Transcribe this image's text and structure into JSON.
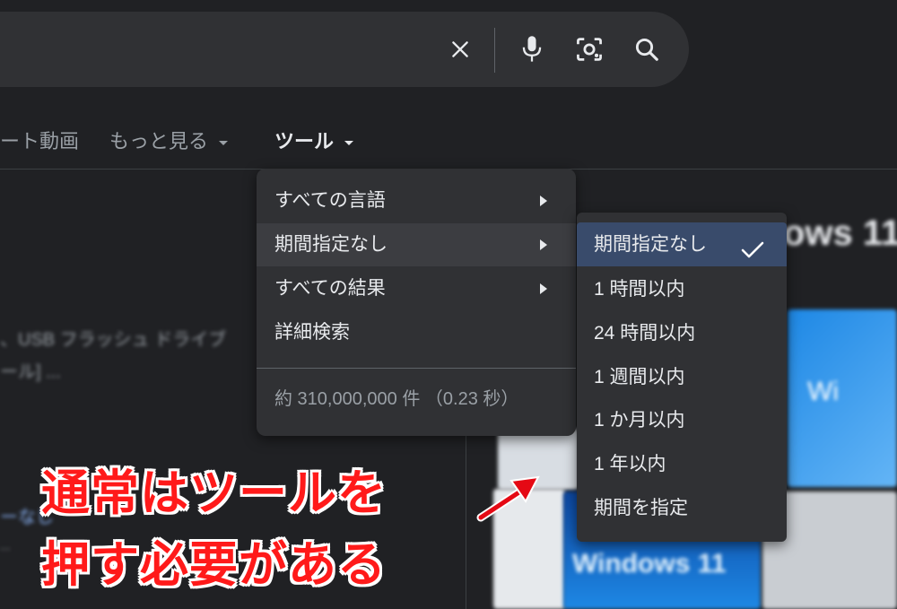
{
  "search": {
    "clear_icon": "close-icon",
    "voice_icon": "mic-icon",
    "lens_icon": "camera-lens-icon",
    "search_icon": "search-icon"
  },
  "tabs": [
    {
      "label": "ート動画"
    },
    {
      "label": "もっと見る"
    },
    {
      "label": "ツール"
    }
  ],
  "background": {
    "snippet_line1": "、USB フラッシュ ドライブ",
    "snippet_line2": "ール] ...",
    "link_partial": "ーなし",
    "heading_partial": "ows 11",
    "thumb_text1": "Wi",
    "thumb_text2": "Windows 11"
  },
  "tools_menu": {
    "items": [
      {
        "label": "すべての言語",
        "has_submenu": true
      },
      {
        "label": "期間指定なし",
        "has_submenu": true
      },
      {
        "label": "すべての結果",
        "has_submenu": true
      },
      {
        "label": "詳細検索",
        "has_submenu": false
      }
    ],
    "result_stats": "約 310,000,000 件 （0.23 秒）"
  },
  "period_submenu": {
    "items": [
      {
        "label": "期間指定なし",
        "selected": true
      },
      {
        "label": "1 時間以内"
      },
      {
        "label": "24 時間以内"
      },
      {
        "label": "1 週間以内"
      },
      {
        "label": "1 か月以内"
      },
      {
        "label": "1 年以内"
      },
      {
        "label": "期間を指定"
      }
    ],
    "check_icon": "check-icon"
  },
  "annotation": {
    "line1": "通常はツールを",
    "line2": "押す必要がある",
    "color": "#ff1a1a"
  }
}
